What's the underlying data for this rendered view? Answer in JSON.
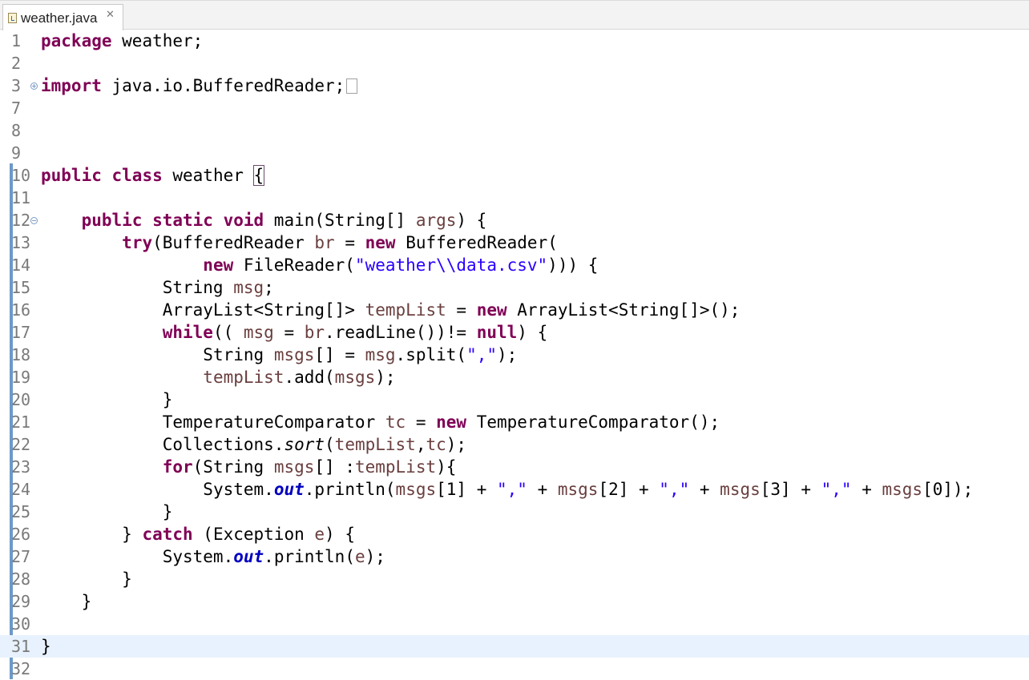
{
  "tab": {
    "title": "weather.java",
    "close_glyph": "✕",
    "icon": "java-file-icon"
  },
  "editor": {
    "line_numbers": [
      "1",
      "2",
      "3",
      "7",
      "8",
      "9",
      "10",
      "11",
      "12",
      "13",
      "14",
      "15",
      "16",
      "17",
      "18",
      "19",
      "20",
      "21",
      "22",
      "23",
      "24",
      "25",
      "26",
      "27",
      "28",
      "29",
      "30",
      "31",
      "32"
    ],
    "fold_expand_glyph": "+",
    "fold_collapse_glyph": "−",
    "code": {
      "l1_package": "package",
      "l1_rest": " weather;",
      "l3_import": "import",
      "l3_rest": " java.io.BufferedReader;",
      "l10_public": "public",
      "l10_class": "class",
      "l10_name": " weather ",
      "l10_brace": "{",
      "l12_indent": "    ",
      "l12_mods": "public static void",
      "l12_main": " main(String[] ",
      "l12_args": "args",
      "l12_end": ") {",
      "l13_indent": "        ",
      "l13_try": "try",
      "l13_a": "(BufferedReader ",
      "l13_br": "br",
      "l13_b": " = ",
      "l13_new": "new",
      "l13_c": " BufferedReader(",
      "l14_indent": "                ",
      "l14_new": "new",
      "l14_a": " FileReader(",
      "l14_str": "\"weather\\\\data.csv\"",
      "l14_b": "))) {",
      "l15_indent": "            ",
      "l15_a": "String ",
      "l15_msg": "msg",
      "l15_b": ";",
      "l16_indent": "            ",
      "l16_a": "ArrayList<String[]> ",
      "l16_var": "tempList",
      "l16_b": " = ",
      "l16_new": "new",
      "l16_c": " ArrayList<String[]>();",
      "l17_indent": "            ",
      "l17_while": "while",
      "l17_a": "(( ",
      "l17_msg": "msg",
      "l17_b": " = ",
      "l17_br": "br",
      "l17_c": ".readLine())!= ",
      "l17_null": "null",
      "l17_d": ") {",
      "l18_indent": "                ",
      "l18_a": "String ",
      "l18_msgs": "msgs",
      "l18_b": "[] = ",
      "l18_msg": "msg",
      "l18_c": ".split(",
      "l18_str": "\",\"",
      "l18_d": ");",
      "l19_indent": "                ",
      "l19_var": "tempList",
      "l19_a": ".add(",
      "l19_msgs": "msgs",
      "l19_b": ");",
      "l20": "            }",
      "l21_indent": "            ",
      "l21_a": "TemperatureComparator ",
      "l21_tc": "tc",
      "l21_b": " = ",
      "l21_new": "new",
      "l21_c": " TemperatureComparator();",
      "l22_indent": "            ",
      "l22_a": "Collections.",
      "l22_sort": "sort",
      "l22_b": "(",
      "l22_var": "tempList",
      "l22_c": ",",
      "l22_tc": "tc",
      "l22_d": ");",
      "l23_indent": "            ",
      "l23_for": "for",
      "l23_a": "(String ",
      "l23_msgs": "msgs",
      "l23_b": "[] :",
      "l23_var": "tempList",
      "l23_c": "){",
      "l24_indent": "                ",
      "l24_a": "System.",
      "l24_out": "out",
      "l24_b": ".println(",
      "l24_m1": "msgs",
      "l24_c": "[1] + ",
      "l24_s1": "\",\"",
      "l24_d": " + ",
      "l24_m2": "msgs",
      "l24_e": "[2] + ",
      "l24_s2": "\",\"",
      "l24_f": " + ",
      "l24_m3": "msgs",
      "l24_g": "[3] + ",
      "l24_s3": "\",\"",
      "l24_h": " + ",
      "l24_m4": "msgs",
      "l24_i": "[0]);",
      "l25": "            }",
      "l26_a": "        } ",
      "l26_catch": "catch",
      "l26_b": " (Exception ",
      "l26_e": "e",
      "l26_c": ") {",
      "l27_indent": "            ",
      "l27_a": "System.",
      "l27_out": "out",
      "l27_b": ".println(",
      "l27_e": "e",
      "l27_c": ");",
      "l28": "        }",
      "l29": "    }",
      "l31": "}"
    }
  }
}
